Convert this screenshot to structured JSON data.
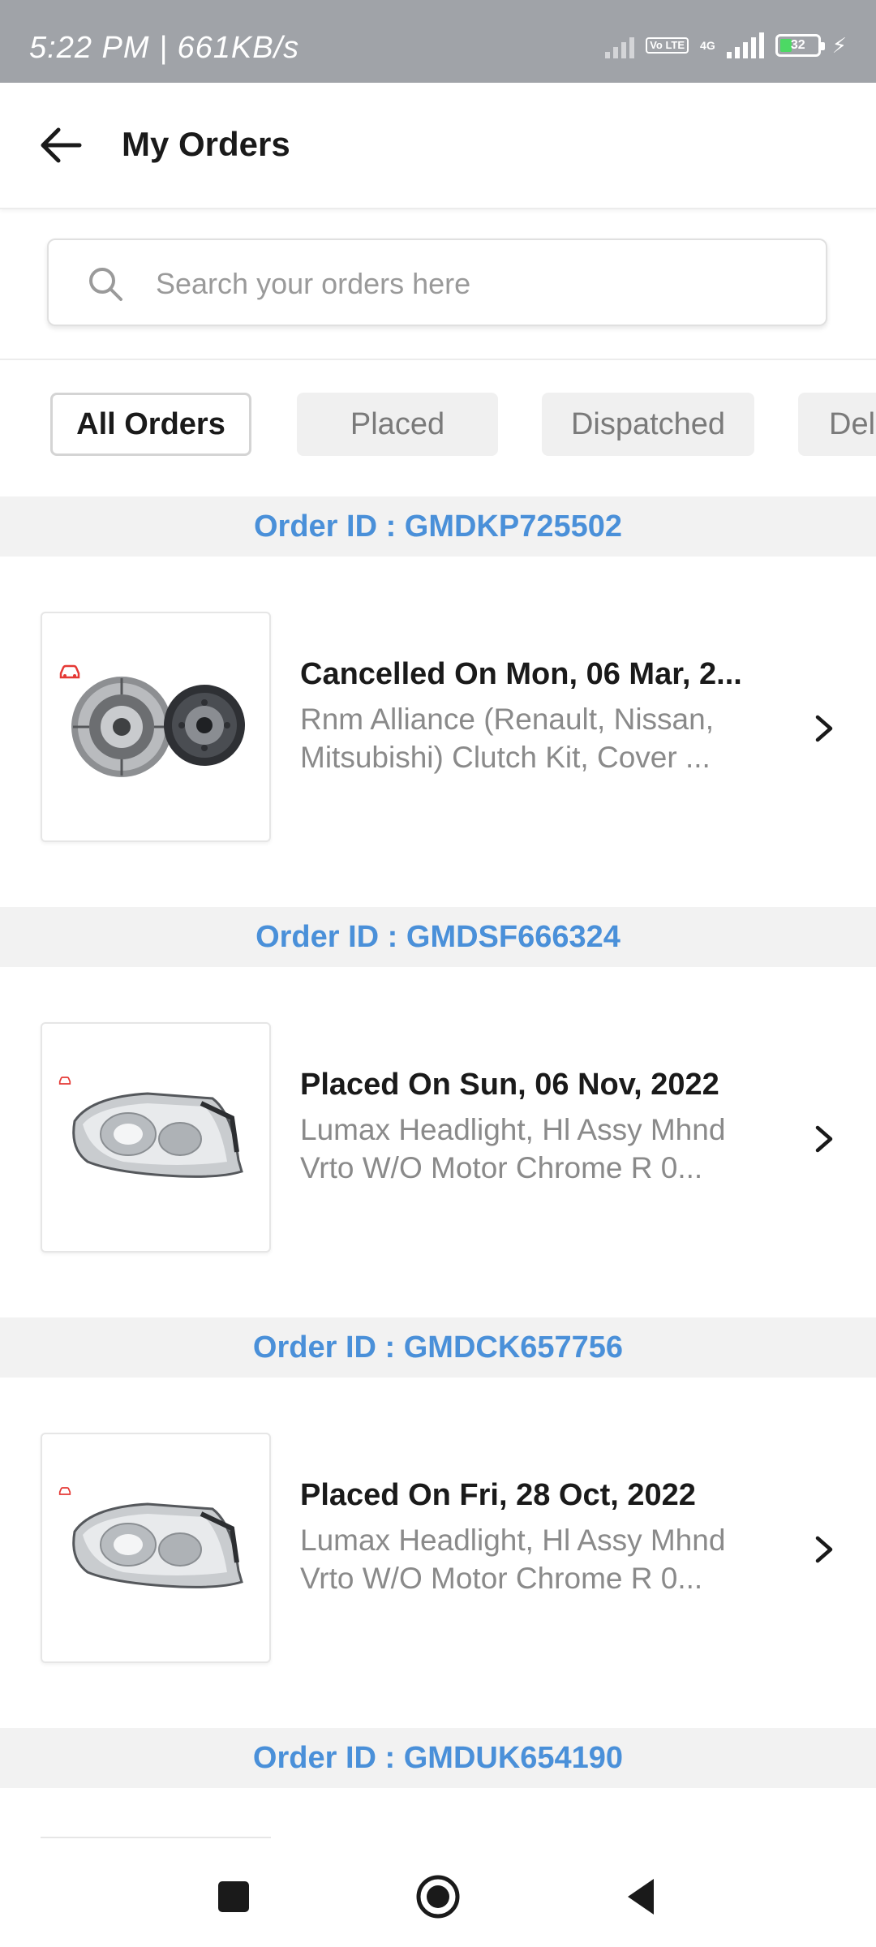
{
  "status_bar": {
    "time": "5:22 PM | 661KB/s",
    "volte": "Vo LTE",
    "network": "4G",
    "battery": "32"
  },
  "header": {
    "title": "My Orders"
  },
  "search": {
    "placeholder": "Search your orders here",
    "value": ""
  },
  "filters": [
    {
      "label": "All Orders",
      "active": true
    },
    {
      "label": "Placed",
      "active": false
    },
    {
      "label": "Dispatched",
      "active": false
    },
    {
      "label": "Del",
      "active": false
    }
  ],
  "orders": [
    {
      "order_id": "Order ID : GMDKP725502",
      "status": "Cancelled On Mon, 06 Mar, 2...",
      "description": "Rnm Alliance (Renault, Nissan, Mitsubishi) Clutch Kit, Cover ...",
      "image_icon": "clutch-kit-image"
    },
    {
      "order_id": "Order ID : GMDSF666324",
      "status": "Placed On Sun, 06 Nov, 2022",
      "description": "Lumax Headlight, Hl Assy Mhnd Vrto W/O Motor Chrome R 0...",
      "image_icon": "headlight-image"
    },
    {
      "order_id": "Order ID : GMDCK657756",
      "status": "Placed On Fri, 28 Oct, 2022",
      "description": "Lumax Headlight, Hl Assy Mhnd Vrto W/O Motor Chrome R 0...",
      "image_icon": "headlight-image"
    },
    {
      "order_id": "Order ID : GMDUK654190"
    }
  ],
  "colors": {
    "accent_blue": "#4a90d9",
    "status_bar_bg": "#a0a3a8",
    "brand_red": "#e53935"
  }
}
